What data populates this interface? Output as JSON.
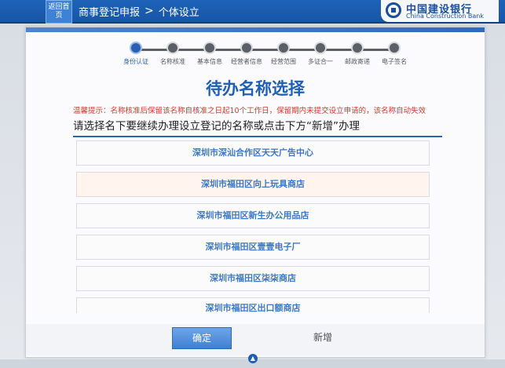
{
  "header": {
    "home_label": "返回首页",
    "breadcrumb_1": "商事登记申报",
    "breadcrumb_sep": ">",
    "breadcrumb_2": "个体设立",
    "bank_name_cn": "中国建设银行",
    "bank_name_en": "China Construction Bank"
  },
  "steps": [
    {
      "label": "身份认证",
      "active": true
    },
    {
      "label": "名称核准",
      "active": false
    },
    {
      "label": "基本信息",
      "active": false
    },
    {
      "label": "经营者信息",
      "active": false
    },
    {
      "label": "经营范围",
      "active": false
    },
    {
      "label": "多证合一",
      "active": false
    },
    {
      "label": "邮政寄递",
      "active": false
    },
    {
      "label": "电子签名",
      "active": false
    }
  ],
  "main": {
    "title": "待办名称选择",
    "warning": "温馨提示：名称核准后保留该名称自核准之日起10个工作日，保留期内未提交设立申请的，该名称自动失效",
    "instruction": "请选择名下要继续办理设立登记的名称或点击下方“新增”办理",
    "names": [
      "深圳市深汕合作区天天广告中心",
      "深圳市福田区向上玩具商店",
      "深圳市福田区新生办公用品店",
      "深圳市福田区壹壹电子厂",
      "深圳市福田区柒柒商店",
      "深圳市福田区出口额商店"
    ]
  },
  "buttons": {
    "ok": "确定",
    "add": "新增"
  },
  "colors": {
    "header_blue": "#1d63b8",
    "title_blue": "#1f5fb4",
    "warning_red": "#d33a2c",
    "name_blue": "#3b78c9"
  }
}
